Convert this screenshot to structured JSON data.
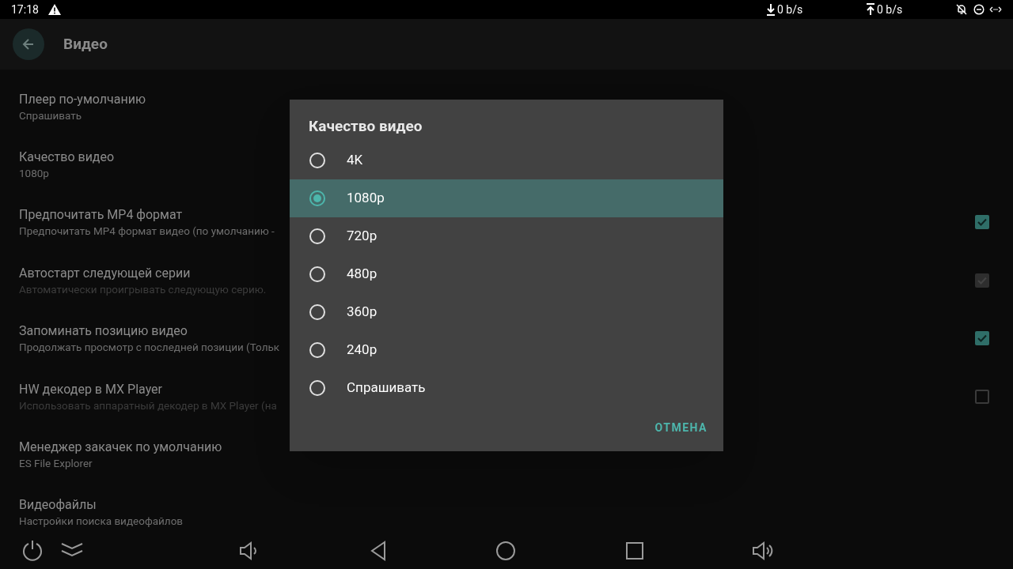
{
  "status_bar": {
    "time": "17:18",
    "download": "0 b/s",
    "upload": "0 b/s"
  },
  "app_bar": {
    "title": "Видео"
  },
  "settings": [
    {
      "kind": "value",
      "title": "Плеер по-умолчанию",
      "summary": "Спрашивать",
      "summary_dim": false
    },
    {
      "kind": "value",
      "title": "Качество видео",
      "summary": "1080p",
      "summary_dim": false
    },
    {
      "kind": "checkbox",
      "title": "Предпочитать MP4 формат",
      "summary": "Предпочитать MP4 формат видео (по умолчанию -",
      "summary_dim": false,
      "checked": true,
      "disabled": false
    },
    {
      "kind": "checkbox",
      "title": "Автостарт следующей серии",
      "summary": "Автоматически проигрывать следующую серию.",
      "summary_dim": true,
      "checked": true,
      "disabled": true
    },
    {
      "kind": "checkbox",
      "title": "Запоминать позицию видео",
      "summary": "Продолжать просмотр с последней позиции (Тольк",
      "summary_dim": false,
      "checked": true,
      "disabled": false
    },
    {
      "kind": "checkbox",
      "title": "HW декодер в MX Player",
      "summary": "Использовать аппаратный декодер в MX Player (на",
      "summary_dim": true,
      "checked": false,
      "disabled": false
    },
    {
      "kind": "value",
      "title": "Менеджер закачек по умолчанию",
      "summary": "ES File Explorer",
      "summary_dim": false
    },
    {
      "kind": "value",
      "title": "Видеофайлы",
      "summary": "Настройки поиска видеофайлов",
      "summary_dim": false
    }
  ],
  "dialog": {
    "title": "Качество видео",
    "options": [
      {
        "label": "4K",
        "selected": false
      },
      {
        "label": "1080p",
        "selected": true
      },
      {
        "label": "720p",
        "selected": false
      },
      {
        "label": "480p",
        "selected": false
      },
      {
        "label": "360p",
        "selected": false
      },
      {
        "label": "240p",
        "selected": false
      },
      {
        "label": "Спрашивать",
        "selected": false
      }
    ],
    "cancel": "ОТМЕНА"
  }
}
